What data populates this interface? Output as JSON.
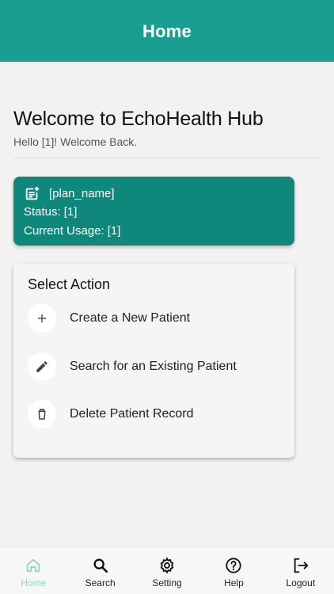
{
  "header": {
    "title": "Home"
  },
  "welcome": {
    "heading": "Welcome to EchoHealth Hub",
    "greeting": "Hello [1]!  Welcome Back."
  },
  "plan": {
    "name": "[plan_name]",
    "status_label": "Status:",
    "status_value": "[1]",
    "usage_label": "Current Usage:",
    "usage_value": "[1]",
    "icon": "note-add-icon"
  },
  "actions": {
    "title": "Select Action",
    "items": [
      {
        "label": "Create a New Patient",
        "icon": "plus-icon"
      },
      {
        "label": "Search for an Existing Patient",
        "icon": "pencil-icon"
      },
      {
        "label": "Delete Patient Record",
        "icon": "trash-icon"
      }
    ]
  },
  "nav": {
    "items": [
      {
        "label": "Home",
        "icon": "home-icon",
        "active": true
      },
      {
        "label": "Search",
        "icon": "search-icon",
        "active": false
      },
      {
        "label": "Setting",
        "icon": "gear-icon",
        "active": false
      },
      {
        "label": "Help",
        "icon": "help-icon",
        "active": false
      },
      {
        "label": "Logout",
        "icon": "logout-icon",
        "active": false
      }
    ]
  },
  "colors": {
    "header": "#1a9e92",
    "plan_card": "#0f877b",
    "nav_active": "#8fd3cc"
  }
}
